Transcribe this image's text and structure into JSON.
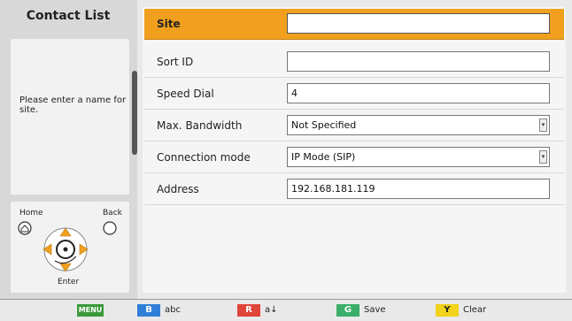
{
  "sidebar": {
    "title": "Contact List",
    "help_text": "Please enter a name for site."
  },
  "nav": {
    "home_label": "Home",
    "back_label": "Back",
    "enter_label": "Enter",
    "home_icon": "house-icon",
    "arrow_color": "#f0a01e"
  },
  "form": {
    "rows": [
      {
        "label": "Site",
        "value": "",
        "type": "text",
        "active": true
      },
      {
        "label": "Sort ID",
        "value": "",
        "type": "text"
      },
      {
        "label": "Speed Dial",
        "value": "4",
        "type": "text"
      },
      {
        "label": "Max. Bandwidth",
        "value": "Not Specified",
        "type": "select"
      },
      {
        "label": "Connection mode",
        "value": "IP Mode (SIP)",
        "type": "select"
      },
      {
        "label": "Address",
        "value": "192.168.181.119",
        "type": "text"
      }
    ]
  },
  "footer": {
    "menu_key": "MENU",
    "b_key": "B",
    "b_label": "abc",
    "r_key": "R",
    "r_label": "a↓",
    "g_key": "G",
    "g_label": "Save",
    "y_key": "Y",
    "y_label": "Clear",
    "colors": {
      "menu": "#3a9a3a",
      "b": "#2f7fd8",
      "r": "#e0453a",
      "g": "#3aae6a",
      "y": "#f2d21a"
    }
  },
  "accent": "#f0a01e"
}
